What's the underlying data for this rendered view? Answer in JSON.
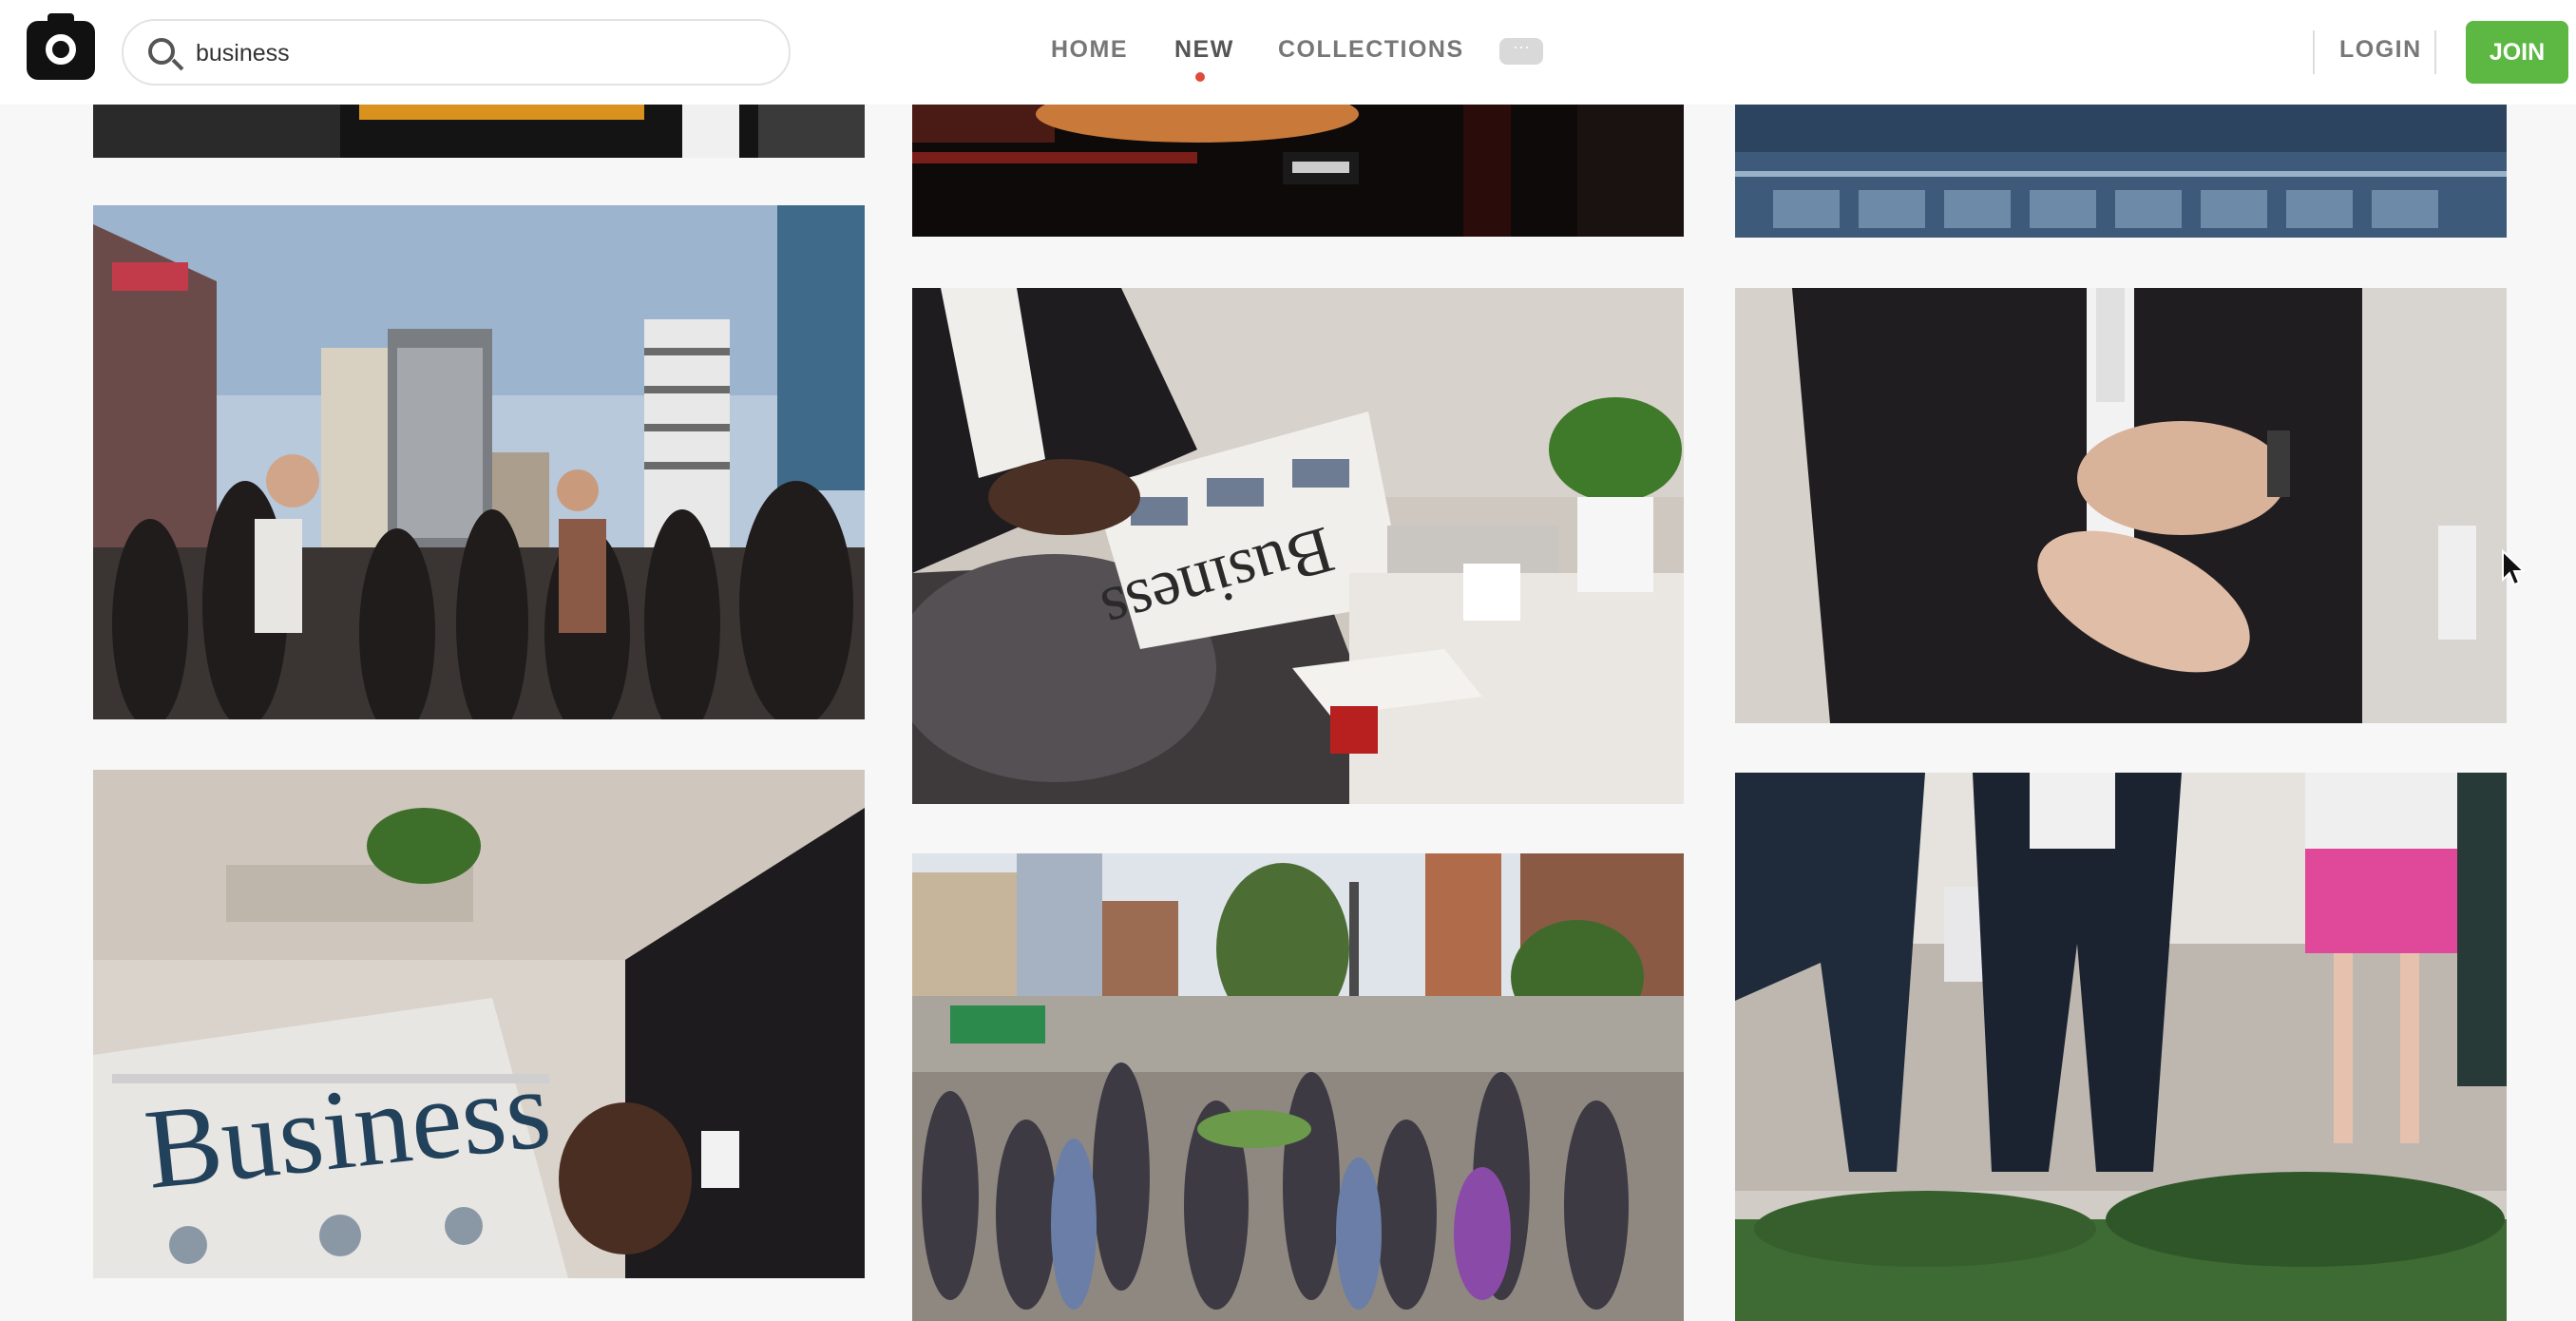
{
  "header": {
    "search": {
      "value": "business",
      "placeholder": ""
    },
    "nav": [
      {
        "label": "HOME",
        "active": false
      },
      {
        "label": "NEW",
        "active": true
      },
      {
        "label": "COLLECTIONS",
        "active": false
      }
    ],
    "more_glyph": "···",
    "login_label": "LOGIN",
    "join_label": "JOIN"
  },
  "photos": [
    {
      "name": "photo-city-crowd",
      "print": ""
    },
    {
      "name": "photo-newspaper-business-reader",
      "print": "Business"
    },
    {
      "name": "photo-man-adjusting-watch",
      "print": ""
    },
    {
      "name": "photo-business-newspaper-closeup",
      "print": "Business"
    },
    {
      "name": "photo-busy-street-crowd",
      "print": ""
    },
    {
      "name": "photo-walking-people-street",
      "print": ""
    }
  ],
  "colors": {
    "join_green": "#5cb843",
    "active_dot": "#e04a3a",
    "nav_text": "#777777"
  }
}
